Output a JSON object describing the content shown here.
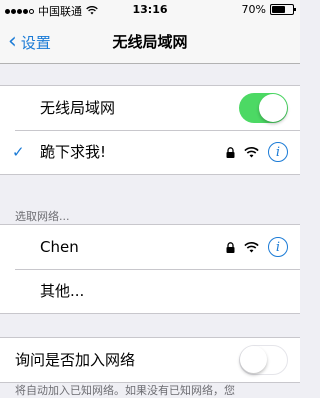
{
  "status_bar": {
    "carrier": "中国联通",
    "time": "13:16",
    "battery_text": "70%",
    "battery_level": 0.7,
    "signal_bars": 4
  },
  "nav": {
    "back_label": "设置",
    "title": "无线局域网"
  },
  "wifi_toggle": {
    "label": "无线局域网",
    "state": "on"
  },
  "connected_network": {
    "name": "跪下求我!",
    "checked": true,
    "secured": true,
    "icons": [
      "checkmark-icon",
      "lock-icon",
      "wifi-icon",
      "info-icon"
    ]
  },
  "choose_network_header": "选取网络...",
  "networks": [
    {
      "name": "Chen",
      "secured": true
    },
    {
      "name": "其他..."
    }
  ],
  "ask_to_join": {
    "label": "询问是否加入网络",
    "state": "off"
  },
  "footer_text": "将自动加入已知网络。如果没有已知网络，您",
  "colors": {
    "accent": "#1b7bd6",
    "toggle_on": "#4cd964",
    "background": "#efeff4"
  }
}
